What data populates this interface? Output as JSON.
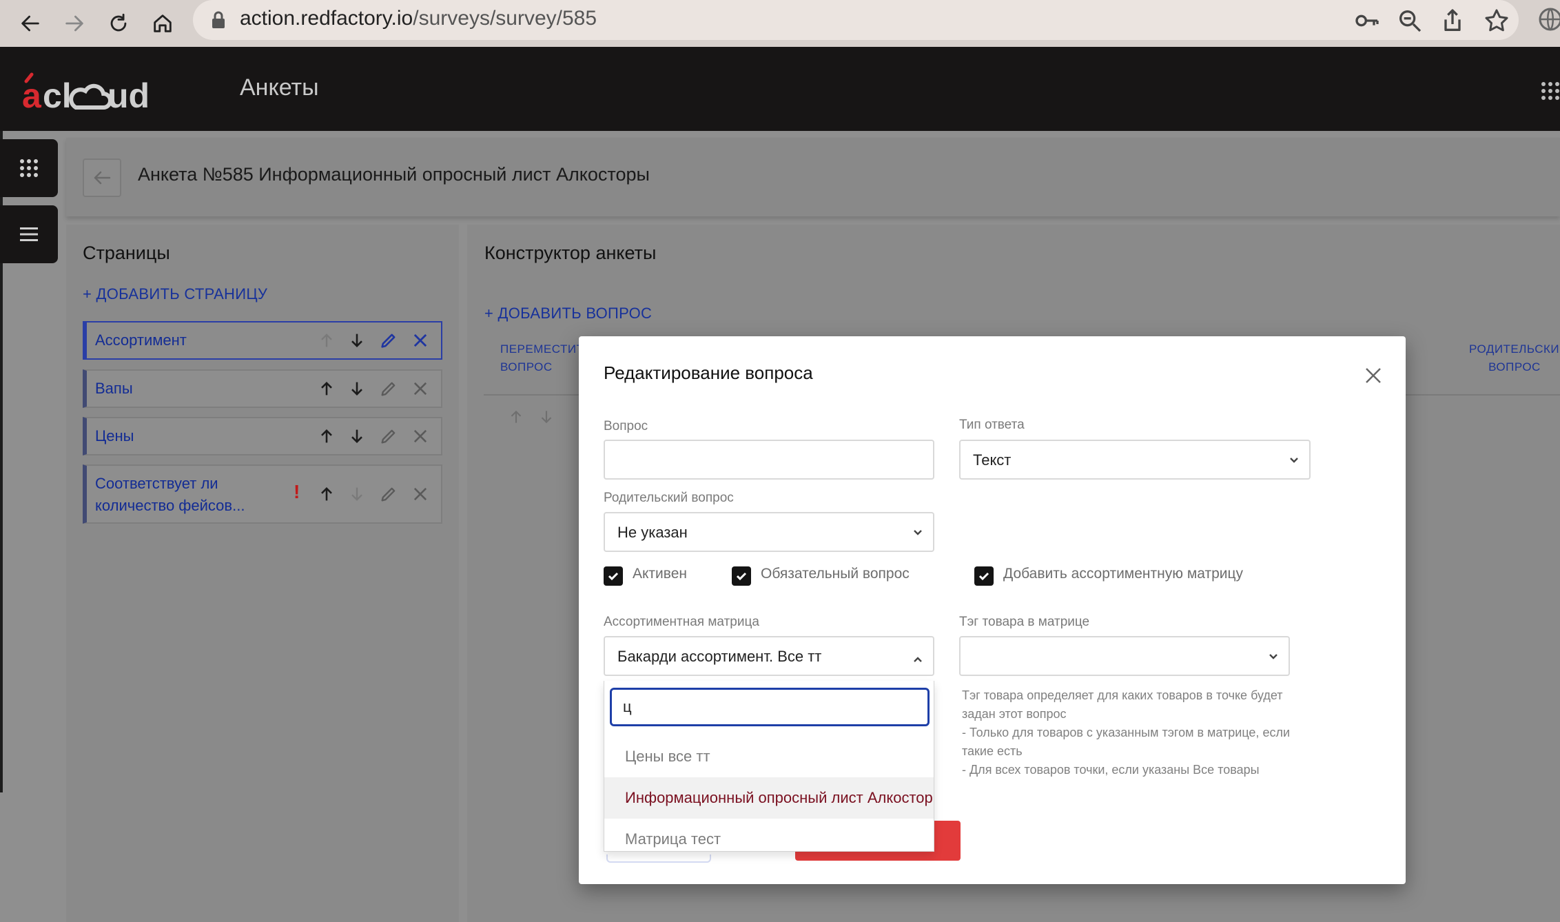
{
  "browser": {
    "url_host": "action.redfactory.io",
    "url_path": "/surveys/survey/585"
  },
  "app": {
    "logo_text": "acloud",
    "title": "Анкеты",
    "accent_color": "#e23b3b"
  },
  "survey_header": {
    "title": "Анкета №585 Информационный опросный лист Алкосторы"
  },
  "pages_panel": {
    "title": "Страницы",
    "add_label": "+ ДОБАВИТЬ СТРАНИЦУ",
    "items": [
      {
        "label": "Ассортимент",
        "active": true
      },
      {
        "label": "Вапы",
        "active": false
      },
      {
        "label": "Цены",
        "active": false
      },
      {
        "label": "Соответствует ли количество фейсов...",
        "active": false,
        "warning": "!"
      }
    ]
  },
  "constructor": {
    "title": "Конструктор анкеты",
    "add_label": "+ ДОБАВИТЬ ВОПРОС",
    "columns": {
      "move": "ПЕРЕМЕСТИТЬ ВОПРОС",
      "parent": "РОДИТЕЛЬСКИЙ ВОПРОС"
    }
  },
  "modal": {
    "title": "Редактирование вопроса",
    "question_label": "Вопрос",
    "question_value": "",
    "answer_type_label": "Тип ответа",
    "answer_type_value": "Текст",
    "parent_label": "Родительский вопрос",
    "parent_value": "Не указан",
    "checkboxes": {
      "active": "Активен",
      "required": "Обязательный вопрос",
      "add_matrix": "Добавить ассортиментную матрицу"
    },
    "matrix_label": "Ассортиментная матрица",
    "matrix_value": "Бакарди ассортимент. Все тт",
    "tag_label": "Тэг товара в матрице",
    "tag_value": "",
    "hint": [
      "Тэг товара определяет для каких товаров в точке будет задан этот вопрос",
      "- Только для товаров с указанным тэгом в матрице, если такие есть",
      "- Для всех товаров точки, если указаны Все товары"
    ]
  },
  "dropdown": {
    "search_value": "ц",
    "options": [
      "Цены все тт",
      "Информационный опросный лист Алкосторы",
      "Матрица тест"
    ]
  }
}
